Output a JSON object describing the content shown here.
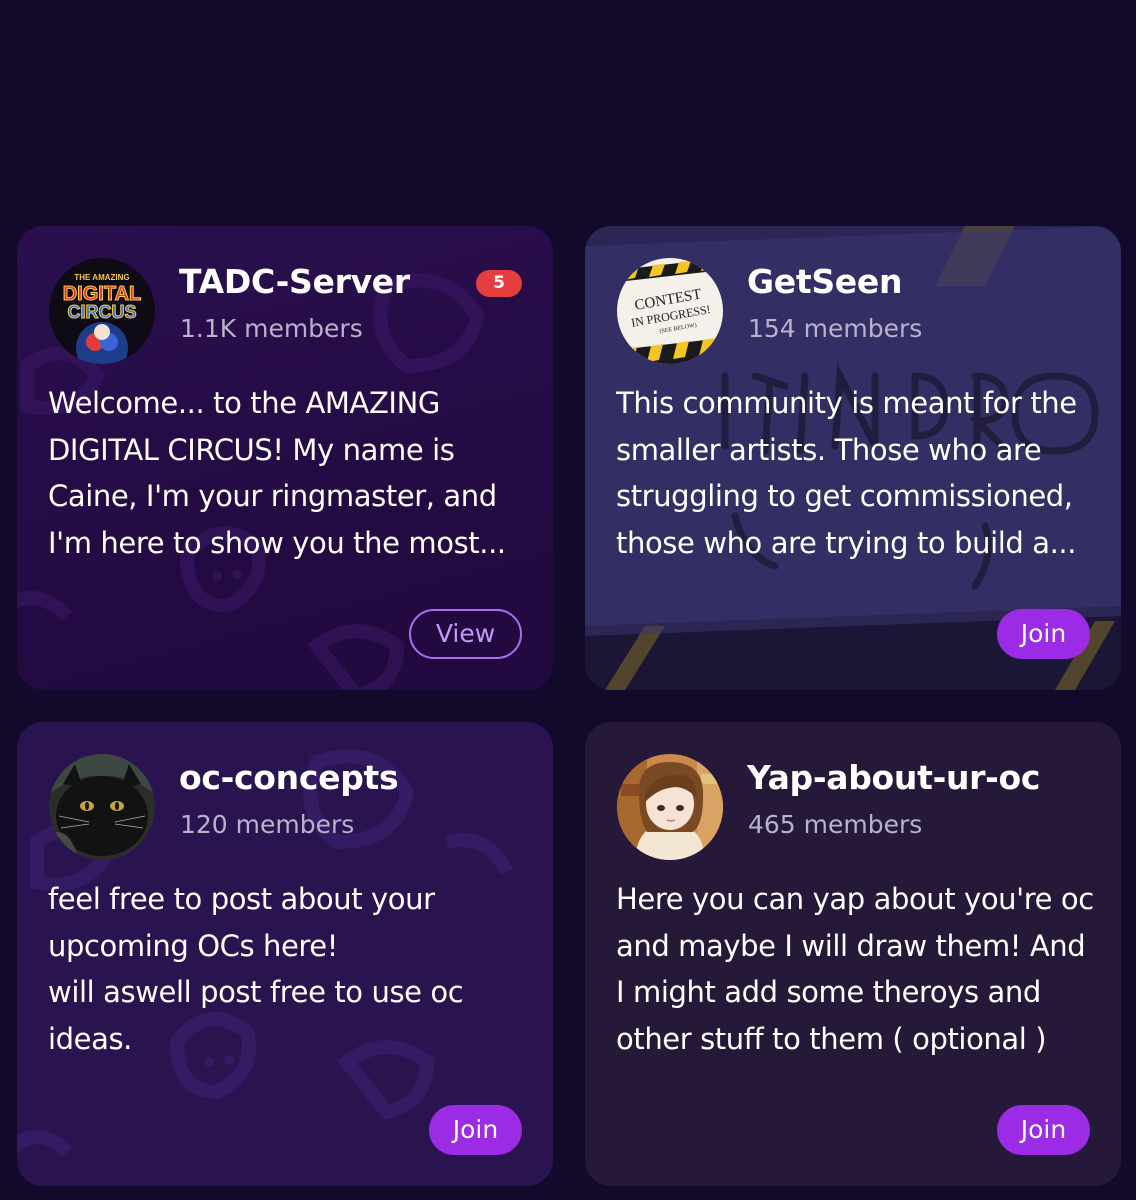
{
  "colors": {
    "page_background": "#130a2b",
    "join_button": "#9b2be5",
    "view_button_outline": "#a66ef0",
    "badge": "#e53e3e",
    "members_text": "#b9b2cc"
  },
  "communities": [
    {
      "name": "TADC-Server",
      "members": "1.1K members",
      "badge": "5",
      "description": "Welcome... to the AMAZING DIGITAL CIRCUS! My name is Caine, I'm your ringmaster, and I'm here to show you the most...",
      "button_label": "View",
      "avatar_icon": "digital-circus-logo",
      "avatar_text": {
        "top": "THE AMAZING",
        "line1": "DIGITAL",
        "line2": "CIRCUS"
      }
    },
    {
      "name": "GetSeen",
      "members": "154 members",
      "description": "This community is meant for the smaller artists. Those who are struggling to get commissioned, those who are trying to build a...",
      "button_label": "Join",
      "avatar_icon": "contest-sign",
      "avatar_text": {
        "line1": "CONTEST",
        "line2": "IN PROGRESS!",
        "line3": "(SEE BELOW)"
      }
    },
    {
      "name": "oc-concepts",
      "members": "120 members",
      "description_lines": [
        "feel free to post about your",
        "upcoming OCs here!",
        "will aswell post free to use oc",
        "ideas."
      ],
      "button_label": "Join",
      "avatar_icon": "black-cat-photo"
    },
    {
      "name": "Yap-about-ur-oc",
      "members": "465 members",
      "description": "Here you can yap about you're oc and maybe I will draw them! And I might add some theroys and other stuff to them ( optional )",
      "button_label": "Join",
      "avatar_icon": "anime-character-portrait"
    }
  ]
}
